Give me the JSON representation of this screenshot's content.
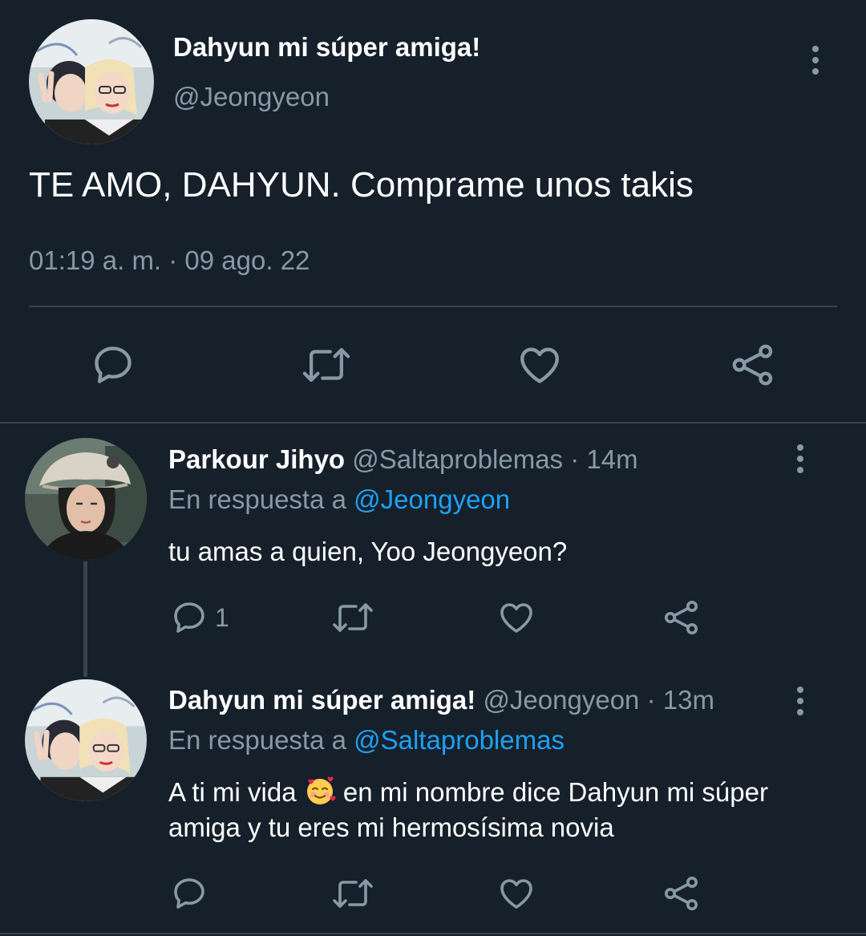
{
  "main_tweet": {
    "display_name": "Dahyun mi súper amiga!",
    "handle": "@Jeongyeon",
    "text": "TE AMO, DAHYUN. Comprame unos takis",
    "timestamp": "01:19 a. m. · 09 ago. 22",
    "actions": [
      "reply-icon",
      "retweet-icon",
      "like-icon",
      "share-icon"
    ]
  },
  "replies": [
    {
      "display_name": "Parkour Jihyo",
      "handle": "@Saltaproblemas",
      "separator": "·",
      "time": "14m",
      "replying_prefix": "En respuesta a",
      "replying_to": "@Jeongyeon",
      "text": "tu amas a quien, Yoo Jeongyeon?",
      "reply_count": "1"
    },
    {
      "display_name": "Dahyun mi súper amiga!",
      "handle": "@Jeongyeon",
      "separator": "·",
      "time": "13m",
      "replying_prefix": "En respuesta a",
      "replying_to": "@Saltaproblemas",
      "text_before_emoji": "A ti mi vida",
      "emoji": "smiling-face-with-hearts",
      "text_after_emoji": "en mi nombre dice Dahyun mi súper amiga y tu eres mi hermosísima novia"
    }
  ],
  "colors": {
    "background": "#15202b",
    "secondary_text": "#8899a6",
    "link": "#1da1f2",
    "divider": "#38444d"
  }
}
